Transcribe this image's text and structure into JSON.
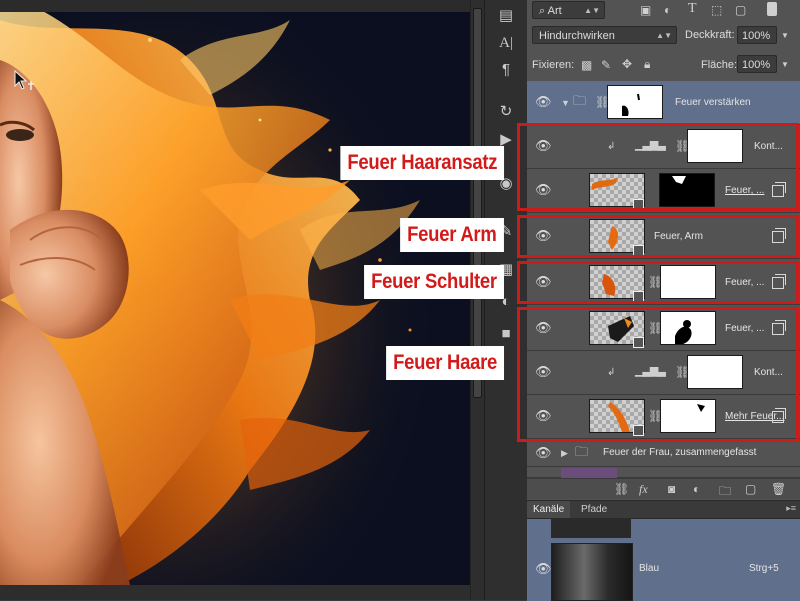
{
  "panel": {
    "filter_kind": "Art",
    "blend_mode": "Hindurchwirken",
    "opacity_label": "Deckkraft:",
    "opacity_value": "100%",
    "lock_label": "Fixieren:",
    "fill_label": "Fläche:",
    "fill_value": "100%"
  },
  "layers": {
    "group_feuer_verstaerken": "Feuer verstärken",
    "kontrast_1": "Kont...",
    "feuer_1": "Feuer, ...",
    "feuer_arm": "Feuer, Arm",
    "feuer_schulter": "Feuer, ...",
    "feuer_haare": "Feuer, ...",
    "kontrast_2": "Kont...",
    "mehr_feuer": "Mehr Feuer...",
    "group_frau": "Feuer der Frau, zusammengefasst"
  },
  "channels": {
    "tab_kanaele": "Kanäle",
    "tab_pfade": "Pfade",
    "channel_name": "Blau",
    "channel_shortcut": "Strg+5"
  },
  "annotations": {
    "haaransatz": "Feuer Haaransatz",
    "arm": "Feuer Arm",
    "schulter": "Feuer Schulter",
    "haare": "Feuer Haare"
  },
  "colors": {
    "annotation_red": "#cc1b1b",
    "selected_layer": "#5f6f8c",
    "flame_orange": "#f08a1c"
  }
}
